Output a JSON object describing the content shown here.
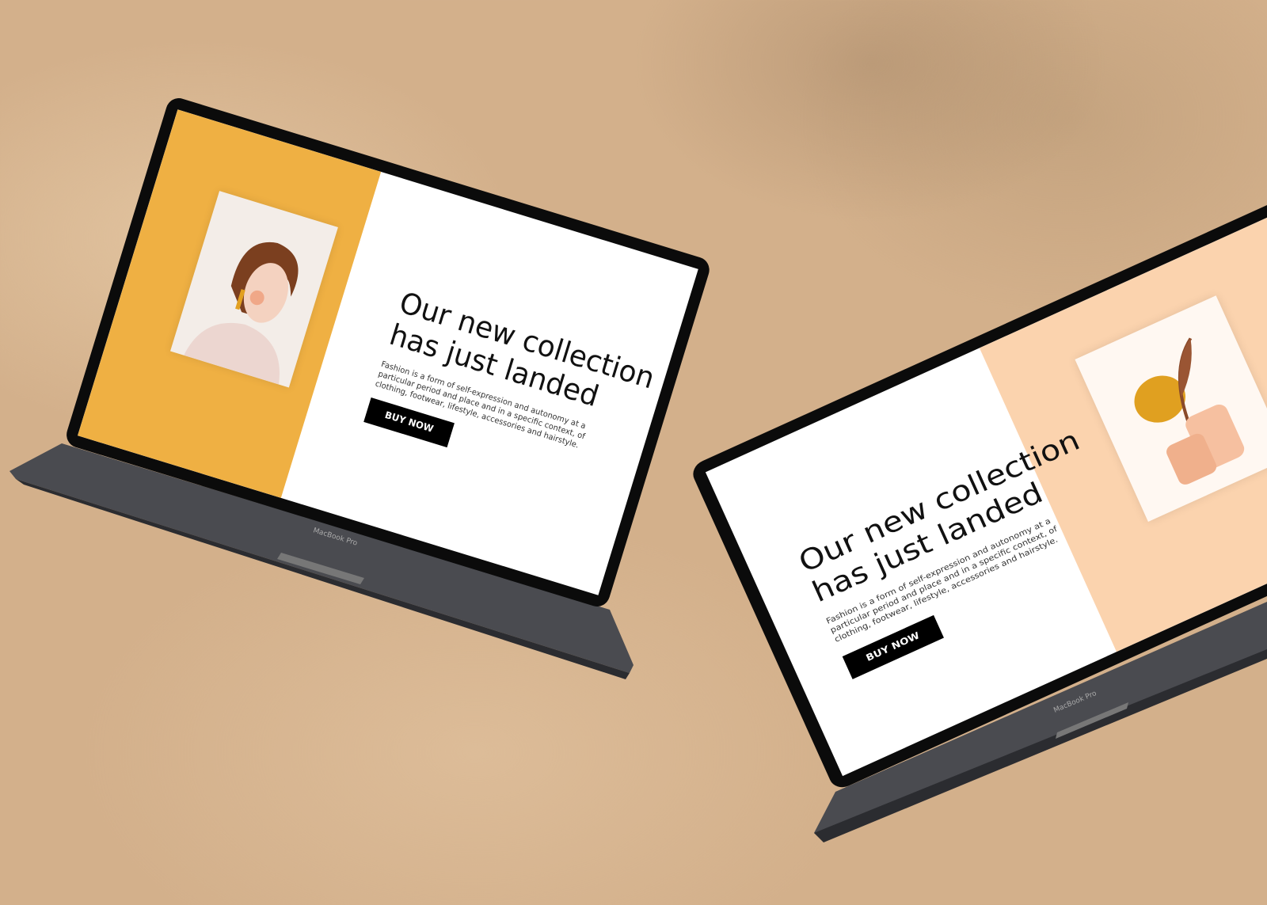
{
  "laptops": [
    {
      "brand": "MacBook Pro",
      "headline_1": "Our new collection",
      "headline_2": "has just landed",
      "description": "Fashion is a form of self-expression and autonomy at a particular period and place and in a specific context, of clothing, footwear, lifestyle, accessories and hairstyle.",
      "button": "BUY NOW",
      "accent": "#efb043",
      "illustration": "woman-portrait"
    },
    {
      "brand": "MacBook Pro",
      "headline_1": "Our new collection",
      "headline_2": "has just landed",
      "description": "Fashion is a form of self-expression and autonomy at a particular period and place and in a specific context, of clothing, footwear, lifestyle, accessories and hairstyle.",
      "button": "BUY NOW",
      "accent": "#fbd3ae",
      "illustration": "vase-leaf"
    }
  ]
}
